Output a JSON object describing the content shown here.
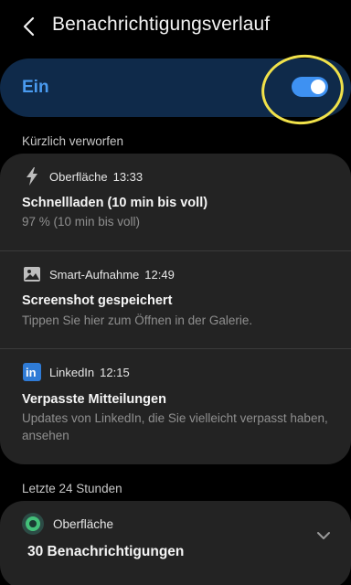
{
  "header": {
    "title": "Benachrichtigungsverlauf",
    "back_icon": "chevron-left-icon"
  },
  "master_switch": {
    "label": "Ein",
    "state": true,
    "accent_color": "#3e91f2",
    "highlight_color": "#f1e24a"
  },
  "recent": {
    "section_label": "Kürzlich verworfen",
    "notifications": [
      {
        "icon": "lightning-bolt-icon",
        "app": "Oberfläche",
        "time": "13:33",
        "title": "Schnellladen (10 min bis voll)",
        "body": "97 % (10 min bis voll)"
      },
      {
        "icon": "image-icon",
        "app": "Smart-Aufnahme",
        "time": "12:49",
        "title": "Screenshot gespeichert",
        "body": "Tippen Sie hier zum Öffnen in der Galerie."
      },
      {
        "icon": "linkedin-logo-icon",
        "app": "LinkedIn",
        "time": "12:15",
        "title": "Verpasste Mitteilungen",
        "body": "Updates von LinkedIn, die Sie vielleicht verpasst haben, ansehen",
        "logo_text": "in"
      }
    ]
  },
  "last24": {
    "section_label": "Letzte 24 Stunden",
    "app_icon": "android-circle-icon",
    "app": "Oberfläche",
    "count_text": "30 Benachrichtigungen",
    "expand_icon": "chevron-down-icon"
  }
}
